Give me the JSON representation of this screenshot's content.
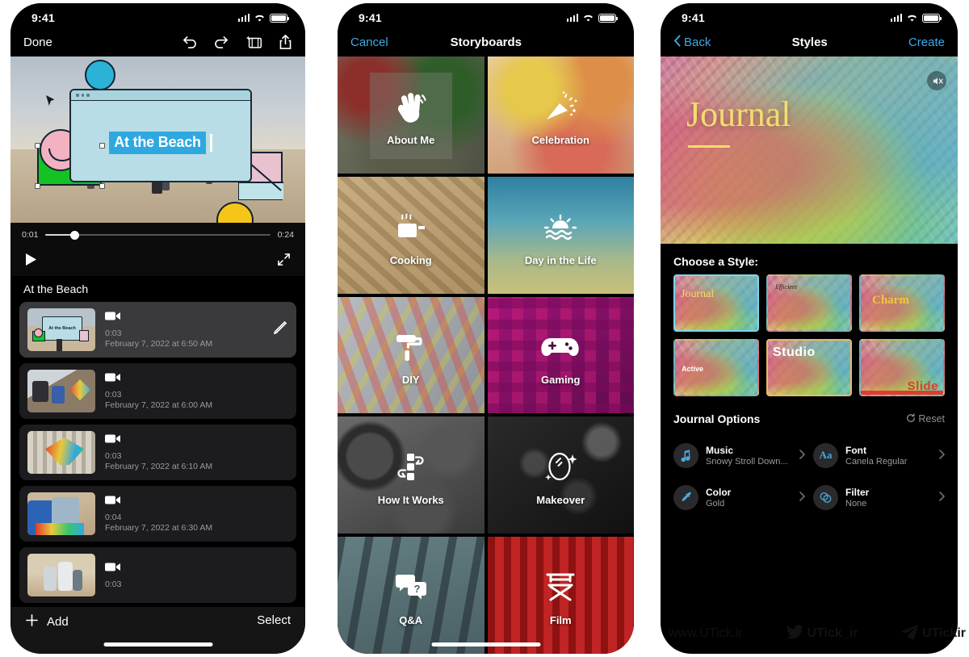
{
  "screens": {
    "editor": {
      "status": {
        "time": "9:41"
      },
      "nav": {
        "done": "Done",
        "undo_icon": "undo-icon",
        "redo_icon": "redo-icon",
        "magic_movie_icon": "magic-movie-icon",
        "share_icon": "share-icon"
      },
      "preview": {
        "overlay_title": "At the Beach"
      },
      "timeline": {
        "current": "0:01",
        "total": "0:24",
        "play_icon": "play-icon",
        "fullscreen_icon": "fullscreen-icon"
      },
      "project_title": "At the Beach",
      "clips": [
        {
          "duration": "0:03",
          "date": "February 7, 2022 at 6:50 AM",
          "selected": true,
          "edit_icon": "pencil-icon"
        },
        {
          "duration": "0:03",
          "date": "February 7, 2022 at 6:00 AM",
          "selected": false
        },
        {
          "duration": "0:03",
          "date": "February 7, 2022 at 6:10 AM",
          "selected": false
        },
        {
          "duration": "0:04",
          "date": "February 7, 2022 at 6:30 AM",
          "selected": false
        },
        {
          "duration": "0:03",
          "date": "",
          "selected": false
        }
      ],
      "bottom": {
        "add": "Add",
        "add_icon": "plus-icon",
        "select": "Select"
      }
    },
    "storyboards": {
      "status": {
        "time": "9:41"
      },
      "nav": {
        "cancel": "Cancel",
        "title": "Storyboards"
      },
      "tiles": [
        {
          "label": "About Me",
          "icon": "waving-hand-icon"
        },
        {
          "label": "Celebration",
          "icon": "party-popper-icon"
        },
        {
          "label": "Cooking",
          "icon": "steaming-cup-icon"
        },
        {
          "label": "Day in the Life",
          "icon": "sunrise-waves-icon"
        },
        {
          "label": "DIY",
          "icon": "paint-roller-icon"
        },
        {
          "label": "Gaming",
          "icon": "gamepad-icon"
        },
        {
          "label": "How It Works",
          "icon": "flowchart-icon"
        },
        {
          "label": "Makeover",
          "icon": "mirror-sparkle-icon"
        },
        {
          "label": "Q&A",
          "icon": "question-bubbles-icon"
        },
        {
          "label": "Film",
          "icon": "director-chair-icon"
        }
      ]
    },
    "styles": {
      "status": {
        "time": "9:41"
      },
      "nav": {
        "back": "Back",
        "back_icon": "chevron-left-icon",
        "title": "Styles",
        "create": "Create"
      },
      "hero": {
        "title": "Journal",
        "mute_icon": "mute-icon"
      },
      "choose_label": "Choose a Style:",
      "style_cards": [
        {
          "label": "Journal",
          "selected": "blue"
        },
        {
          "label": "Efficient",
          "selected": "none"
        },
        {
          "label": "Charm",
          "selected": "none"
        },
        {
          "label": "Active",
          "selected": "none"
        },
        {
          "label": "Studio",
          "selected": "orange"
        },
        {
          "label": "Slide",
          "selected": "none"
        }
      ],
      "options_title": "Journal Options",
      "reset": {
        "label": "Reset",
        "icon": "reset-icon"
      },
      "options": [
        {
          "name": "Music",
          "value": "Snowy Stroll Down...",
          "icon": "music-note-icon"
        },
        {
          "name": "Font",
          "value": "Canela Regular",
          "icon": "aa-icon"
        },
        {
          "name": "Color",
          "value": "Gold",
          "icon": "eyedropper-icon"
        },
        {
          "name": "Filter",
          "value": "None",
          "icon": "filter-icon"
        }
      ]
    }
  },
  "footer": {
    "website": "www.UTick.ir",
    "twitter_handle": "UTick_ir",
    "twitter_icon": "twitter-bird-icon",
    "telegram_handle": "UTickir",
    "telegram_icon": "telegram-plane-icon"
  },
  "colors": {
    "accent_blue": "#3da8e8",
    "overlay_title_bg": "#2fa8e0",
    "journal_yellow": "#f2dd6e"
  }
}
